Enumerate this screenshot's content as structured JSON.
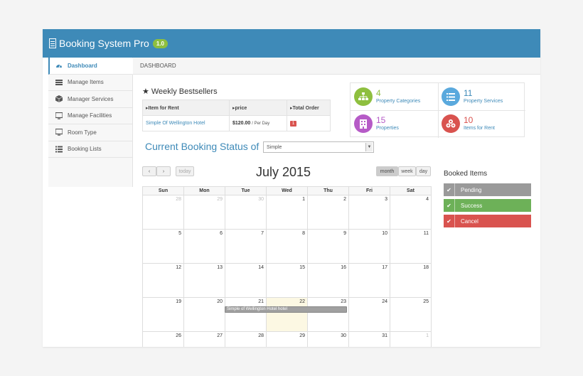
{
  "header": {
    "brand": "Booking System Pro",
    "version": "1.0"
  },
  "sidebar": {
    "items": [
      {
        "label": "Dashboard",
        "icon": "dashboard-icon"
      },
      {
        "label": "Manage Items",
        "icon": "list-icon"
      },
      {
        "label": "Manager Services",
        "icon": "cube-icon"
      },
      {
        "label": "Manage Facilities",
        "icon": "monitor-icon"
      },
      {
        "label": "Room Type",
        "icon": "monitor-icon"
      },
      {
        "label": "Booking Lists",
        "icon": "list-icon"
      }
    ]
  },
  "breadcrumb": "DASHBOARD",
  "bestsellers": {
    "title": "Weekly Bestsellers",
    "columns": [
      "Item for Rent",
      "price",
      "Total Order"
    ],
    "rows": [
      {
        "item": "Simple Of Wellington Hotel",
        "price": "$120.00",
        "per": "/ Per Day",
        "orders": "1"
      }
    ]
  },
  "stats": [
    {
      "number": "4",
      "label": "Property Categories",
      "color": "#8ebf3f",
      "text_color": "#8ebf3f"
    },
    {
      "number": "11",
      "label": "Property Services",
      "color": "#5aa9dd",
      "text_color": "#3e8ab8"
    },
    {
      "number": "15",
      "label": "Properties",
      "color": "#b65bc7",
      "text_color": "#b65bc7"
    },
    {
      "number": "10",
      "label": "Items for Rent",
      "color": "#d9534f",
      "text_color": "#d9534f"
    }
  ],
  "status": {
    "title": "Current Booking Status of",
    "selected": "Simple"
  },
  "calendar": {
    "title": "July 2015",
    "today_label": "today",
    "views": [
      "month",
      "week",
      "day"
    ],
    "weekdays": [
      "Sun",
      "Mon",
      "Tue",
      "Wed",
      "Thu",
      "Fri",
      "Sat"
    ],
    "weeks": [
      [
        "28",
        "29",
        "30",
        "1",
        "2",
        "3",
        "4"
      ],
      [
        "5",
        "6",
        "7",
        "8",
        "9",
        "10",
        "11"
      ],
      [
        "12",
        "13",
        "14",
        "15",
        "16",
        "17",
        "18"
      ],
      [
        "19",
        "20",
        "21",
        "22",
        "23",
        "24",
        "25"
      ],
      [
        "26",
        "27",
        "28",
        "29",
        "30",
        "31",
        "1"
      ]
    ],
    "event": "Simple of Wellington Hotel hotel"
  },
  "booked": {
    "title": "Booked Items",
    "items": [
      {
        "label": "Pending",
        "color": "#9a9a9a"
      },
      {
        "label": "Success",
        "color": "#6db158"
      },
      {
        "label": "Cancel",
        "color": "#d9534f"
      }
    ]
  }
}
